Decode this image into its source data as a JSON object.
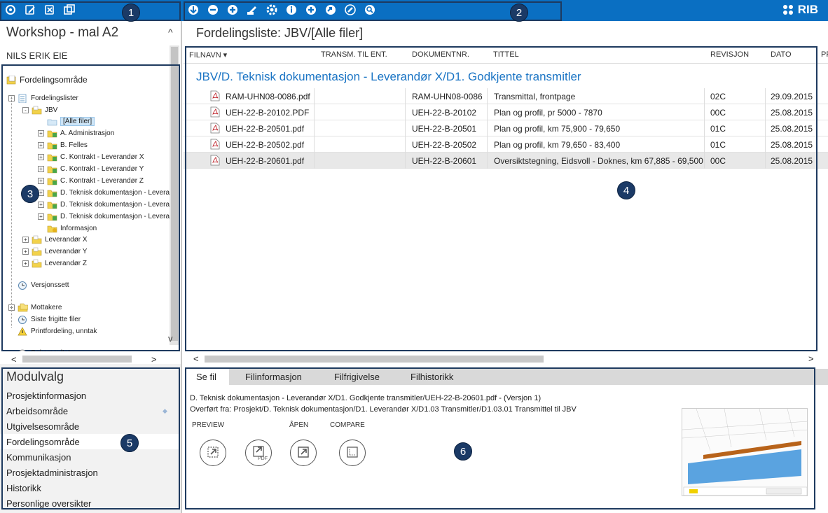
{
  "colors": {
    "topbar": "#0a6fc2",
    "accent_text": "#1a74c4",
    "callout": "#1b3a66"
  },
  "toolbar_left": [
    {
      "icon": "settings-gear-icon"
    },
    {
      "icon": "edit-document-icon"
    },
    {
      "icon": "delete-document-icon"
    },
    {
      "icon": "copy-window-icon"
    }
  ],
  "toolbar_right": [
    {
      "icon": "download-icon"
    },
    {
      "icon": "remove-icon"
    },
    {
      "icon": "add-icon"
    },
    {
      "icon": "edit-pencil-icon"
    },
    {
      "icon": "settings-icon"
    },
    {
      "icon": "info-icon"
    },
    {
      "icon": "add-circle-icon"
    },
    {
      "icon": "forward-icon"
    },
    {
      "icon": "link-icon"
    },
    {
      "icon": "search-document-icon"
    }
  ],
  "brand": "RIB",
  "callouts": [
    "1",
    "2",
    "3",
    "4",
    "5",
    "6"
  ],
  "left": {
    "title": "Workshop - mal A2",
    "collapse": "^",
    "user": "NILS ERIK EIE",
    "tree": [
      {
        "label": "Fordelingsområde",
        "level": 0,
        "expander": "",
        "icon": "folder-note-icon"
      },
      {
        "label": "Fordelingslister",
        "level": 1,
        "expander": "-",
        "icon": "list-folder-icon"
      },
      {
        "label": "JBV",
        "level": 2,
        "expander": "-",
        "icon": "folder-yellow-icon"
      },
      {
        "label": "[Alle filer]",
        "level": 3,
        "expander": "",
        "icon": "open-folder-icon",
        "selected": true
      },
      {
        "label": "A. Administrasjon",
        "level": 3,
        "expander": "+",
        "icon": "folder-green-icon"
      },
      {
        "label": "B. Felles",
        "level": 3,
        "expander": "+",
        "icon": "folder-green-icon"
      },
      {
        "label": "C. Kontrakt - Leverandør X",
        "level": 3,
        "expander": "+",
        "icon": "folder-green-icon"
      },
      {
        "label": "C. Kontrakt - Leverandør Y",
        "level": 3,
        "expander": "+",
        "icon": "folder-green-icon"
      },
      {
        "label": "C. Kontrakt - Leverandør Z",
        "level": 3,
        "expander": "+",
        "icon": "folder-green-icon"
      },
      {
        "label": "D. Teknisk dokumentasjon - Levera",
        "level": 3,
        "expander": "+",
        "icon": "folder-green-icon"
      },
      {
        "label": "D. Teknisk dokumentasjon - Levera",
        "level": 3,
        "expander": "+",
        "icon": "folder-green-icon"
      },
      {
        "label": "D. Teknisk dokumentasjon - Levera",
        "level": 3,
        "expander": "+",
        "icon": "folder-green-icon"
      },
      {
        "label": "Informasjon",
        "level": 3,
        "expander": "",
        "icon": "folder-info-icon"
      },
      {
        "label": "Leverandør X",
        "level": 2,
        "expander": "+",
        "icon": "folder-yellow-icon"
      },
      {
        "label": "Leverandør Y",
        "level": 2,
        "expander": "+",
        "icon": "folder-yellow-icon"
      },
      {
        "label": "Leverandør Z",
        "level": 2,
        "expander": "+",
        "icon": "folder-yellow-icon"
      },
      {
        "label": "Versjonssett",
        "level": 1,
        "expander": "",
        "icon": "version-clock-icon"
      },
      {
        "label": "Mottakere",
        "level": 1,
        "expander": "+",
        "icon": "recipients-icon"
      },
      {
        "label": "Siste frigitte filer",
        "level": 1,
        "expander": "",
        "icon": "recent-clock-icon"
      },
      {
        "label": "Printfordeling, unntak",
        "level": 1,
        "expander": "",
        "icon": "warning-icon"
      },
      {
        "label": "Søkeresultat",
        "level": 1,
        "expander": "",
        "icon": "search-result-icon"
      }
    ]
  },
  "modulvalg": {
    "title": "Modulvalg",
    "items": [
      "Prosjektinformasjon",
      "Arbeidsområde",
      "Utgivelsesområde",
      "Fordelingsområde",
      "Kommunikasjon",
      "Prosjektadministrasjon",
      "Historikk",
      "Personlige oversikter"
    ],
    "active_index": 3,
    "pin_index": 1,
    "pin_symbol": "◆"
  },
  "main": {
    "title": "Fordelingsliste: JBV/[Alle filer]",
    "columns": [
      "FILNAVN",
      "TRANSM. TIL ENT.",
      "DOKUMENTNR.",
      "TITTEL",
      "REVISJON",
      "DATO",
      "PRO"
    ],
    "sort_indicator": "▾",
    "group_title": "JBV/D. Teknisk dokumentasjon - Leverandør X/D1. Godkjente transmitler",
    "rows": [
      {
        "file": "RAM-UHN08-0086.pdf",
        "transm": "",
        "docno": "RAM-UHN08-0086",
        "title": "Transmittal, frontpage",
        "rev": "02C",
        "date": "29.09.2015"
      },
      {
        "file": "UEH-22-B-20102.PDF",
        "transm": "",
        "docno": "UEH-22-B-20102",
        "title": "Plan og profil, pr 5000 - 7870",
        "rev": "00C",
        "date": "25.08.2015"
      },
      {
        "file": "UEH-22-B-20501.pdf",
        "transm": "",
        "docno": "UEH-22-B-20501",
        "title": "Plan og profil, km 75,900 - 79,650",
        "rev": "01C",
        "date": "25.08.2015"
      },
      {
        "file": "UEH-22-B-20502.pdf",
        "transm": "",
        "docno": "UEH-22-B-20502",
        "title": "Plan og profil, km 79,650 - 83,400",
        "rev": "01C",
        "date": "25.08.2015"
      },
      {
        "file": "UEH-22-B-20601.pdf",
        "transm": "",
        "docno": "UEH-22-B-20601",
        "title": "Oversiktstegning, Eidsvoll - Doknes, km 67,885 - 69,500",
        "rev": "00C",
        "date": "25.08.2015",
        "selected": true
      }
    ]
  },
  "bottom": {
    "tabs": [
      "Se fil",
      "Filinformasjon",
      "Filfrigivelse",
      "Filhistorikk"
    ],
    "active_tab": 0,
    "line1": "D. Teknisk dokumentasjon - Leverandør X/D1. Godkjente transmitler/UEH-22-B-20601.pdf -   (Versjon 1)",
    "line2": "Overført fra: Prosjekt/D. Teknisk dokumentasjon/D1. Leverandør X/D1.03 Transmitler/D1.03.01 Transmittel til JBV",
    "actions": [
      {
        "label": "PREVIEW",
        "icon": "preview-icon"
      },
      {
        "label": "",
        "icon": "pdf-preview-icon",
        "badge": "PDF"
      },
      {
        "label": "ÅPEN",
        "icon": "open-external-icon"
      },
      {
        "label": "COMPARE",
        "icon": "compare-icon"
      }
    ]
  },
  "scroll": {
    "left": "<",
    "right": ">",
    "up": "^",
    "down": "v"
  }
}
